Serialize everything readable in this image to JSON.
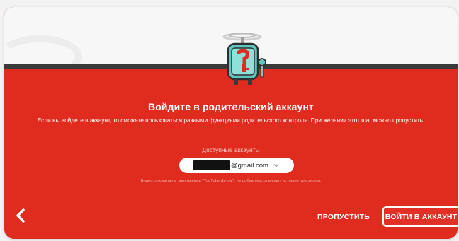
{
  "dialog": {
    "title": "Войдите в родительский аккаунт",
    "description": "Если вы войдете в аккаунт, то сможете пользоваться разными функциями родительского контроля. При желании этот шаг можно пропустить.",
    "accounts_label": "Доступные аккаунты",
    "selected_account_domain": "@gmail.com",
    "history_note": "Видео, открытые в приложении \"YouTube Детям\", не добавляются в вашу историю просмотра."
  },
  "actions": {
    "skip_label": "ПРОПУСТИТЬ",
    "signin_label": "ВОЙТИ В АККАУНТ"
  },
  "icons": {
    "back": "chevron-left-icon",
    "dropdown": "chevron-down-icon",
    "illustration": "robot-key-illustration"
  },
  "colors": {
    "accent_red": "#e02b1f",
    "top_band": "#f7f7f7",
    "dark_strip": "#3a3a3a",
    "text": "#ffffff"
  }
}
